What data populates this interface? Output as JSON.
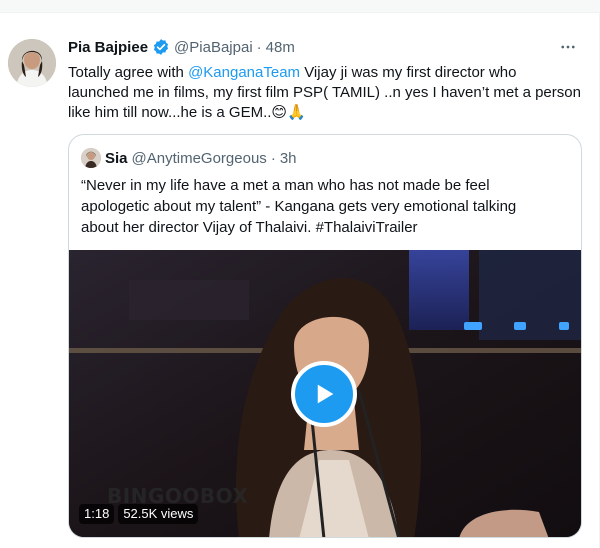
{
  "tweet": {
    "author": {
      "display_name": "Pia Bajpiee",
      "handle": "@PiaBajpai",
      "verified": true,
      "avatar_icon": "profile-photo"
    },
    "separator": "·",
    "time": "48m",
    "more_icon": "more-horizontal-icon",
    "text_lines": [
      {
        "before": "Totally agree with ",
        "mention": "@KanganaTeam",
        "after": " Vijay ji was my first director who"
      },
      {
        "text": "launched me in films, my first film PSP( TAMIL)  ..n yes I haven’t met a person"
      },
      {
        "text": "like him till now...he is a GEM..😊🙏"
      }
    ]
  },
  "quote": {
    "author": {
      "display_name": "Sia",
      "handle": "@AnytimeGorgeous",
      "avatar_icon": "profile-photo"
    },
    "separator": "·",
    "time": "3h",
    "text_lines": [
      "“Never in my life have a met a man who has not made be feel",
      "apologetic about my talent” - Kangana gets very emotional talking",
      "about her director Vijay of Thalaivi. #ThalaiviTrailer"
    ],
    "video": {
      "play_icon": "play-icon",
      "watermark": "BINGOOBOX",
      "duration": "1:18",
      "views": "52.5K views"
    }
  },
  "colors": {
    "accent": "#1d9bf0",
    "text": "#0f1419",
    "secondary": "#536471",
    "border": "#cfd9de"
  }
}
